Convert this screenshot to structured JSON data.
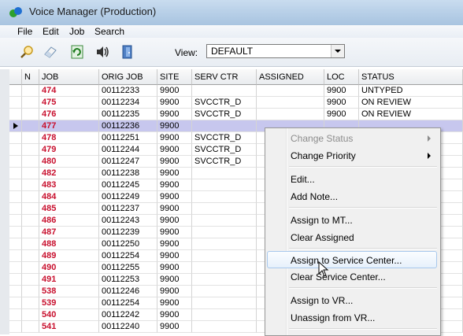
{
  "window": {
    "title": "Voice Manager (Production)"
  },
  "menu": [
    "File",
    "Edit",
    "Job",
    "Search"
  ],
  "toolbar": {
    "icons": [
      "search-icon",
      "eraser-icon",
      "refresh-icon",
      "speaker-icon",
      "exit-door-icon"
    ],
    "view_label": "View:",
    "view_value": "DEFAULT"
  },
  "table": {
    "columns": [
      "N",
      "JOB",
      "ORIG JOB",
      "SITE",
      "SERV CTR",
      "ASSIGNED",
      "LOC",
      "STATUS"
    ],
    "rows": [
      [
        "",
        "474",
        "00112233",
        "9900",
        "",
        "",
        "9900",
        "UNTYPED"
      ],
      [
        "",
        "475",
        "00112234",
        "9900",
        "SVCCTR_D",
        "",
        "9900",
        "ON REVIEW"
      ],
      [
        "",
        "476",
        "00112235",
        "9900",
        "SVCCTR_D",
        "",
        "9900",
        "ON REVIEW"
      ],
      [
        "",
        "477",
        "00112236",
        "9900",
        "",
        "",
        "",
        ""
      ],
      [
        "",
        "478",
        "00112251",
        "9900",
        "SVCCTR_D",
        "",
        "",
        ""
      ],
      [
        "",
        "479",
        "00112244",
        "9900",
        "SVCCTR_D",
        "",
        "",
        ""
      ],
      [
        "",
        "480",
        "00112247",
        "9900",
        "SVCCTR_D",
        "",
        "",
        ""
      ],
      [
        "",
        "482",
        "00112238",
        "9900",
        "",
        "",
        "",
        ""
      ],
      [
        "",
        "483",
        "00112245",
        "9900",
        "",
        "",
        "",
        ""
      ],
      [
        "",
        "484",
        "00112249",
        "9900",
        "",
        "",
        "",
        ""
      ],
      [
        "",
        "485",
        "00112237",
        "9900",
        "",
        "",
        "",
        ""
      ],
      [
        "",
        "486",
        "00112243",
        "9900",
        "",
        "",
        "",
        ""
      ],
      [
        "",
        "487",
        "00112239",
        "9900",
        "",
        "",
        "",
        ""
      ],
      [
        "",
        "488",
        "00112250",
        "9900",
        "",
        "",
        "",
        ""
      ],
      [
        "",
        "489",
        "00112254",
        "9900",
        "",
        "",
        "",
        ""
      ],
      [
        "",
        "490",
        "00112255",
        "9900",
        "",
        "",
        "",
        ""
      ],
      [
        "",
        "491",
        "00112253",
        "9900",
        "",
        "",
        "",
        ""
      ],
      [
        "",
        "538",
        "00112246",
        "9900",
        "",
        "",
        "",
        ""
      ],
      [
        "",
        "539",
        "00112254",
        "9900",
        "",
        "",
        "",
        ""
      ],
      [
        "",
        "540",
        "00112242",
        "9900",
        "",
        "",
        "",
        ""
      ],
      [
        "",
        "541",
        "00112240",
        "9900",
        "",
        "",
        "",
        ""
      ]
    ],
    "selected_row": 3
  },
  "context_menu": {
    "items": [
      {
        "label": "Change Status",
        "disabled": true,
        "submenu": true
      },
      {
        "label": "Change Priority",
        "disabled": false,
        "submenu": true
      },
      {
        "label": "Edit...",
        "disabled": false,
        "submenu": false
      },
      {
        "label": "Add Note...",
        "disabled": false,
        "submenu": false
      },
      {
        "label": "Assign to MT...",
        "disabled": false,
        "submenu": false
      },
      {
        "label": "Clear Assigned",
        "disabled": false,
        "submenu": false
      },
      {
        "label": "Assign to Service Center...",
        "disabled": false,
        "submenu": false,
        "hover": true
      },
      {
        "label": "Clear Service Center...",
        "disabled": false,
        "submenu": false
      },
      {
        "label": "Assign to VR...",
        "disabled": false,
        "submenu": false
      },
      {
        "label": "Unassign from VR...",
        "disabled": false,
        "submenu": false
      }
    ]
  }
}
